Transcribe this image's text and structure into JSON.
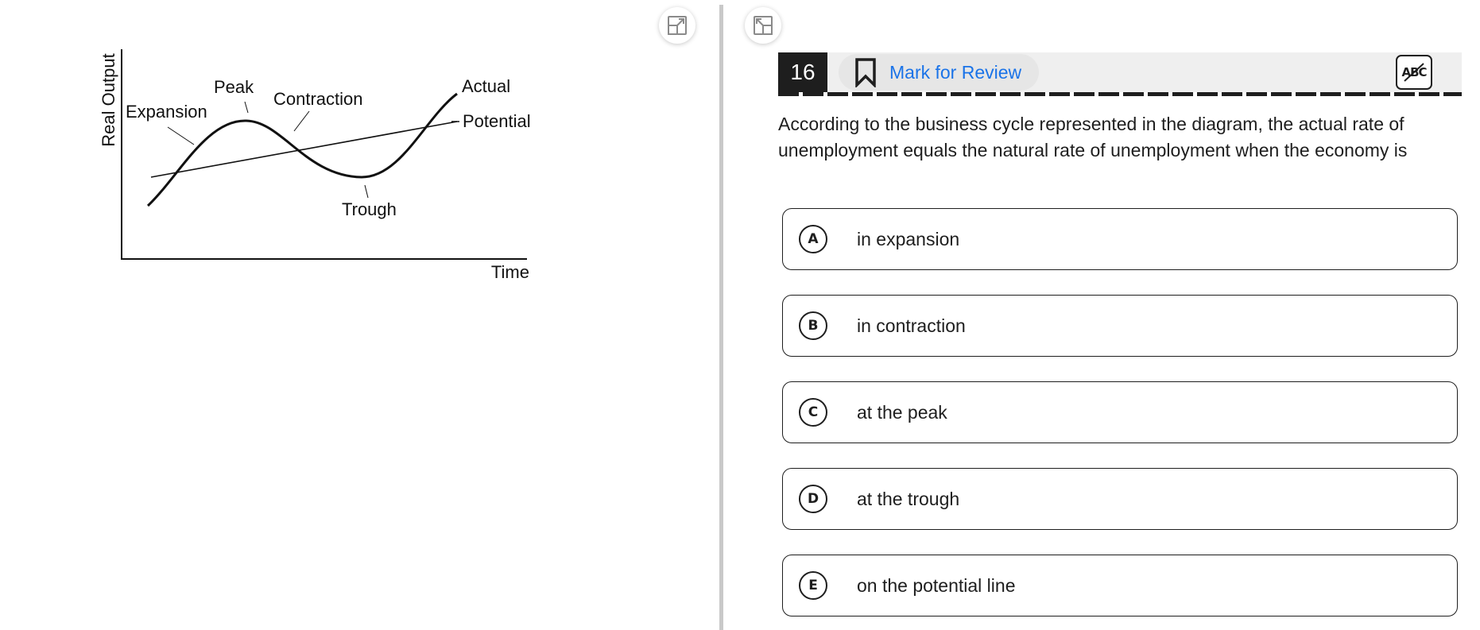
{
  "diagram": {
    "y_axis_label": "Real Output",
    "x_axis_label": "Time",
    "labels": {
      "expansion": "Expansion",
      "peak": "Peak",
      "contraction": "Contraction",
      "trough": "Trough",
      "actual": "Actual",
      "potential": "Potential"
    }
  },
  "question": {
    "number": "16",
    "mark_for_review": "Mark for Review",
    "abc_tool": "ABC",
    "stem": "According to the business cycle represented in the diagram, the actual rate of unemployment equals the natural rate of unemployment when the economy is",
    "choices": [
      {
        "letter": "A",
        "text": "in expansion"
      },
      {
        "letter": "B",
        "text": "in contraction"
      },
      {
        "letter": "C",
        "text": "at the peak"
      },
      {
        "letter": "D",
        "text": "at the trough"
      },
      {
        "letter": "E",
        "text": "on the potential line"
      }
    ]
  },
  "icons": {
    "expand_left": "expand-pane-icon",
    "expand_right": "collapse-pane-icon",
    "bookmark": "bookmark-icon",
    "abc_strike": "strikethrough-abc-icon"
  }
}
